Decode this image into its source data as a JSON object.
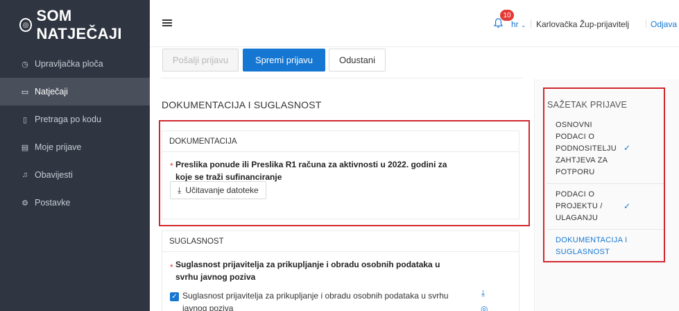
{
  "sidebar": {
    "logo": "SOM NATJEČAJI",
    "items": [
      {
        "label": "Upravljačka ploča",
        "icon": "dashboard-icon",
        "active": false
      },
      {
        "label": "Natječaji",
        "icon": "folder-icon",
        "active": true
      },
      {
        "label": "Pretraga po kodu",
        "icon": "document-icon",
        "active": false
      },
      {
        "label": "Moje prijave",
        "icon": "file-text-icon",
        "active": false
      },
      {
        "label": "Obavijesti",
        "icon": "bell-icon",
        "active": false
      },
      {
        "label": "Postavke",
        "icon": "gear-icon",
        "active": false
      }
    ]
  },
  "header": {
    "notifications_count": "10",
    "language": "hr",
    "user": "Karlovačka Žup-prijavitelj",
    "logout": "Odjava"
  },
  "actions": {
    "send_label": "Pošalji prijavu",
    "save_label": "Spremi prijavu",
    "cancel_label": "Odustani"
  },
  "main": {
    "section_title": "DOKUMENTACIJA I SUGLASNOST",
    "documentation": {
      "title": "DOKUMENTACIJA",
      "field_label_line1": "Preslika ponude ili Preslika R1 računa za aktivnosti u 2022. godini za",
      "field_label_line2": "koje se traži sufinanciranje",
      "upload_label": "Učitavanje datoteke"
    },
    "consent": {
      "title": "SUGLASNOST",
      "field_label_line1": "Suglasnost prijavitelja za prikupljanje i obradu osobnih podataka u",
      "field_label_line2": "svrhu javnog poziva",
      "checkbox_line1": "Suglasnost prijavitelja za prikupljanje i obradu osobnih podataka u svrhu",
      "checkbox_line2": "javnog poziva",
      "checked": true
    }
  },
  "summary": {
    "title": "SAŽETAK PRIJAVE",
    "items": [
      {
        "lines": [
          "OSNOVNI",
          "PODACI O",
          "PODNOSITELJU",
          "ZAHTJEVA ZA",
          "POTPORU"
        ],
        "done": true
      },
      {
        "lines": [
          "PODACI O",
          "PROJEKTU /",
          "ULAGANJU"
        ],
        "done": true
      },
      {
        "lines": [
          "DOKUMENTACIJA I",
          "SUGLASNOST"
        ],
        "done": false,
        "current": true
      }
    ]
  },
  "colors": {
    "accent": "#1677d2",
    "sidebar_bg": "#2f3541",
    "highlight": "#d0272d",
    "badge": "#e53935"
  }
}
